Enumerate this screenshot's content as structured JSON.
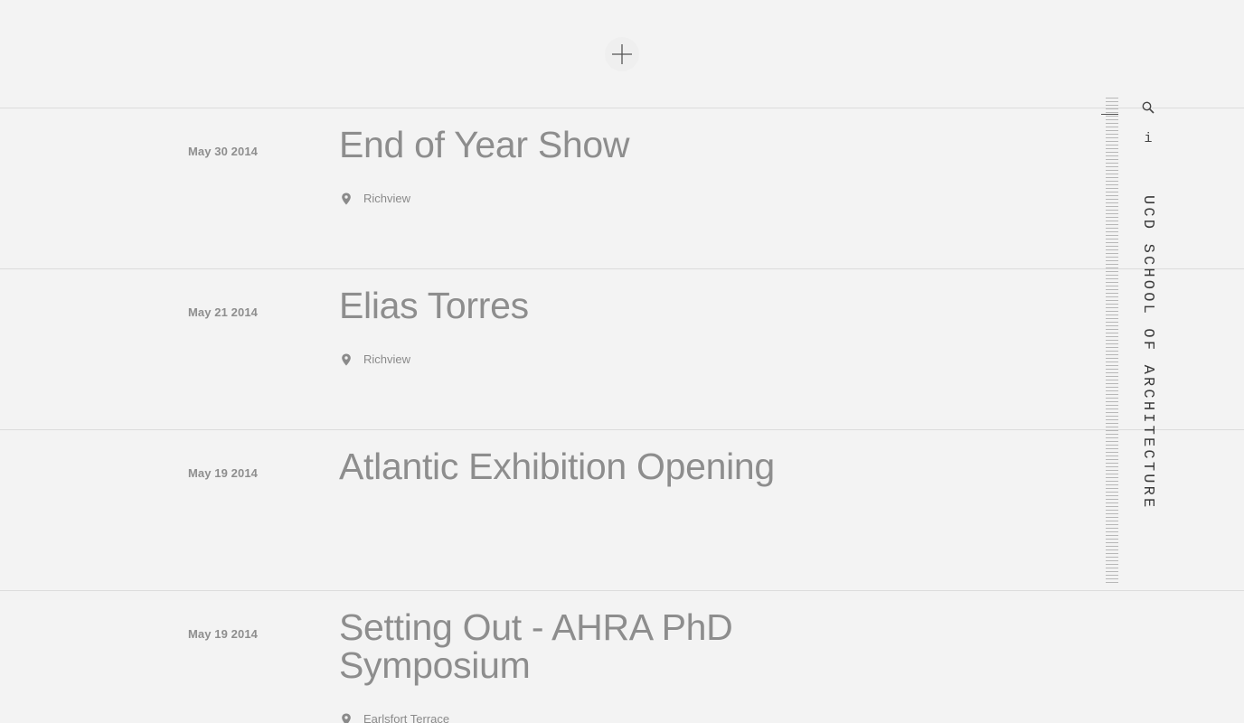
{
  "add_button": {
    "icon": "plus-icon"
  },
  "sidebar": {
    "site_name": "UCD SCHOOL OF ARCHITECTURE",
    "search_icon": "search-icon",
    "info_label": "i"
  },
  "events": [
    {
      "date": "May 30 2014",
      "title": "End of Year Show",
      "location": "Richview"
    },
    {
      "date": "May 21 2014",
      "title": "Elias Torres",
      "location": "Richview"
    },
    {
      "date": "May 19 2014",
      "title": "Atlantic Exhibition Opening",
      "location": ""
    },
    {
      "date": "May 19 2014",
      "title": "Setting Out - AHRA PhD Symposium",
      "location": "Earlsfort Terrace"
    }
  ],
  "colors": {
    "background": "#f3f3f3",
    "text": "#8a8a8a",
    "divider": "#dcdcdc",
    "sidebar_text": "#3a3a3a"
  }
}
